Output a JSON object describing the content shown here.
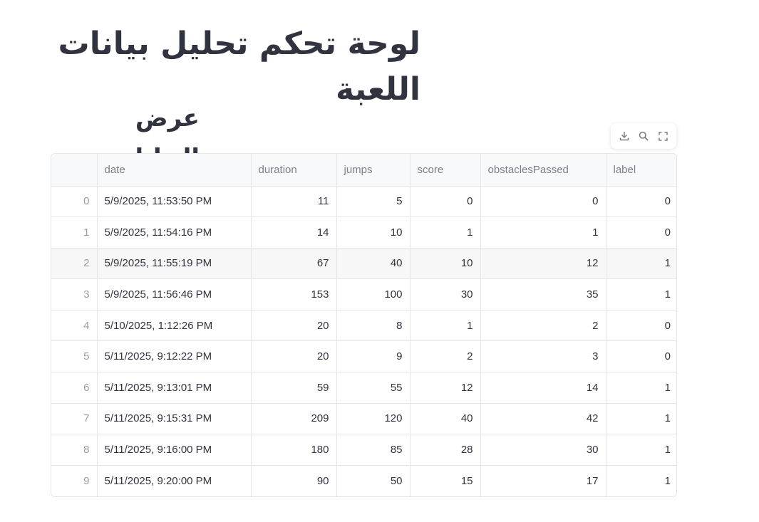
{
  "page": {
    "title": "لوحة تحكم تحليل بيانات اللعبة",
    "subtitle": "عرض البيانات"
  },
  "toolbar": {
    "buttons": [
      {
        "icon": "download-icon"
      },
      {
        "icon": "search-icon"
      },
      {
        "icon": "fullscreen-icon"
      }
    ]
  },
  "table": {
    "columns": [
      "",
      "date",
      "duration",
      "jumps",
      "score",
      "obstaclesPassed",
      "label"
    ],
    "rows": [
      {
        "index": "0",
        "date": "5/9/2025, 11:53:50 PM",
        "duration": "11",
        "jumps": "5",
        "score": "0",
        "obstaclesPassed": "0",
        "label": "0"
      },
      {
        "index": "1",
        "date": "5/9/2025, 11:54:16 PM",
        "duration": "14",
        "jumps": "10",
        "score": "1",
        "obstaclesPassed": "1",
        "label": "0"
      },
      {
        "index": "2",
        "date": "5/9/2025, 11:55:19 PM",
        "duration": "67",
        "jumps": "40",
        "score": "10",
        "obstaclesPassed": "12",
        "label": "1"
      },
      {
        "index": "3",
        "date": "5/9/2025, 11:56:46 PM",
        "duration": "153",
        "jumps": "100",
        "score": "30",
        "obstaclesPassed": "35",
        "label": "1"
      },
      {
        "index": "4",
        "date": "5/10/2025, 1:12:26 PM",
        "duration": "20",
        "jumps": "8",
        "score": "1",
        "obstaclesPassed": "2",
        "label": "0"
      },
      {
        "index": "5",
        "date": "5/11/2025, 9:12:22 PM",
        "duration": "20",
        "jumps": "9",
        "score": "2",
        "obstaclesPassed": "3",
        "label": "0"
      },
      {
        "index": "6",
        "date": "5/11/2025, 9:13:01 PM",
        "duration": "59",
        "jumps": "55",
        "score": "12",
        "obstaclesPassed": "14",
        "label": "1"
      },
      {
        "index": "7",
        "date": "5/11/2025, 9:15:31 PM",
        "duration": "209",
        "jumps": "120",
        "score": "40",
        "obstaclesPassed": "42",
        "label": "1"
      },
      {
        "index": "8",
        "date": "5/11/2025, 9:16:00 PM",
        "duration": "180",
        "jumps": "85",
        "score": "28",
        "obstaclesPassed": "30",
        "label": "1"
      },
      {
        "index": "9",
        "date": "5/11/2025, 9:20:00 PM",
        "duration": "90",
        "jumps": "50",
        "score": "15",
        "obstaclesPassed": "17",
        "label": "1"
      }
    ],
    "highlighted_row": 2
  }
}
